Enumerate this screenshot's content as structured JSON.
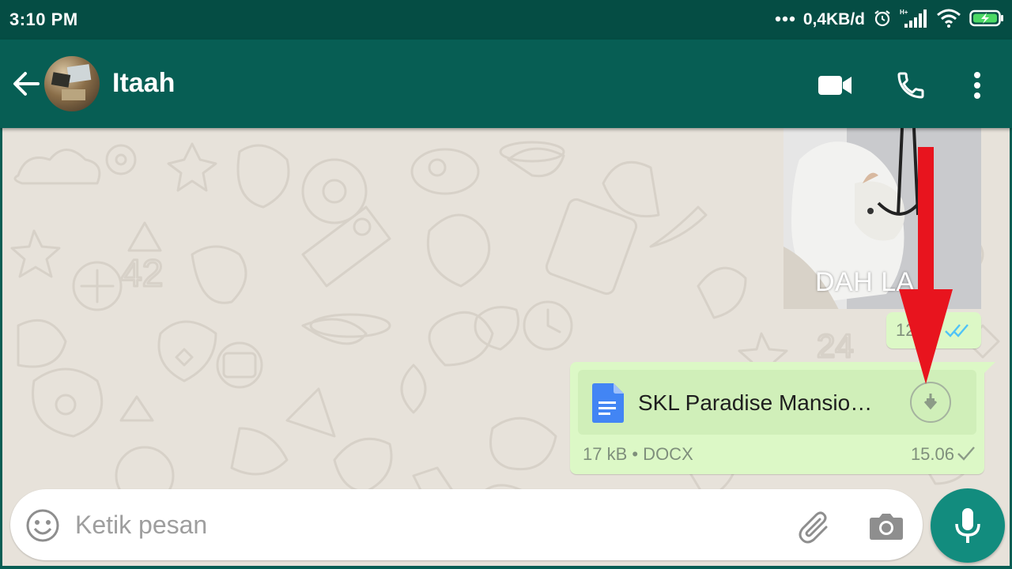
{
  "status_bar": {
    "time": "3:10 PM",
    "network_speed": "0,4KB/d",
    "icons": [
      "dots-icon",
      "alarm-icon",
      "signal-icon",
      "wifi-icon",
      "battery-charging-icon"
    ]
  },
  "header": {
    "contact_name": "Itaah",
    "back_icon": "arrow-left-icon",
    "actions": [
      "video-call-icon",
      "phone-icon",
      "more-vert-icon"
    ]
  },
  "messages": [
    {
      "type": "image",
      "caption": "DAH LA",
      "time": "12.55",
      "status": "read"
    },
    {
      "type": "document",
      "file_name": "SKL Paradise Mansio…",
      "file_meta": "17 kB • DOCX",
      "time": "15.06",
      "status": "sent",
      "action_icon": "download-icon"
    }
  ],
  "composer": {
    "placeholder": "Ketik pesan",
    "value": ""
  },
  "colors": {
    "primary": "#075e54",
    "status_bar": "#054d44",
    "bubble_out": "#dcf8c6",
    "accent": "#128c7e",
    "chat_bg": "#e7e2da",
    "read_tick": "#4fc3f7",
    "annotation": "#e8141e"
  }
}
